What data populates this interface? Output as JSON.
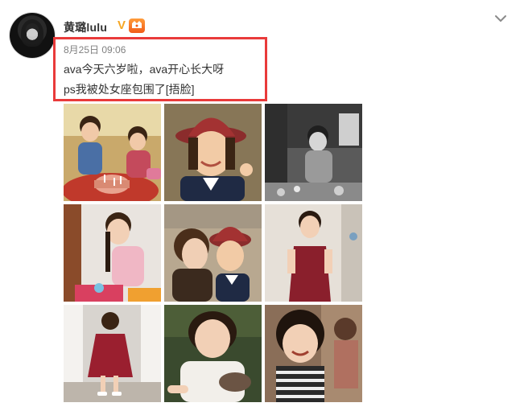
{
  "post": {
    "author": "黄璐lulu",
    "vip_mark": "V",
    "timestamp": "8月25日 09:06",
    "lines": [
      "ava今天六岁啦，ava开心长大呀",
      "ps我被处女座包围了[捂脸]"
    ]
  },
  "photos": [
    {
      "label": "birthday-cake-photo"
    },
    {
      "label": "girl-red-hat-photo"
    },
    {
      "label": "girl-bw-photo"
    },
    {
      "label": "girl-pink-dress-photo"
    },
    {
      "label": "mother-daughter-photo"
    },
    {
      "label": "girl-red-dress-photo"
    },
    {
      "label": "girl-walking-photo"
    },
    {
      "label": "girl-white-tshirt-photo"
    },
    {
      "label": "girl-smiling-photo"
    }
  ],
  "icons": {
    "avatar": "avatar",
    "vip": "vip-badge-icon",
    "member": "member-badge-icon",
    "menu": "chevron-down-icon"
  },
  "colors": {
    "highlight": "#e93a3a",
    "vip": "#f6a623",
    "timestamp": "#808080"
  }
}
